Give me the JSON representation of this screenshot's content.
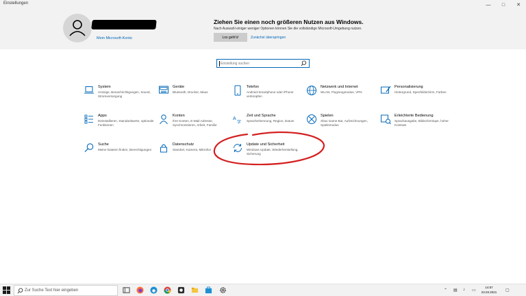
{
  "window": {
    "title": "Einstellungen"
  },
  "account": {
    "link": "Mein Microsoft-Konto"
  },
  "promo": {
    "title": "Ziehen Sie einen noch größeren Nutzen aus Windows.",
    "subtitle": "Nach Auswahl einiger weniger Optionen können Sie die vollständige Microsoft-Umgebung nutzen.",
    "primary_button": "Los geht's!",
    "secondary_link": "Zunächst überspringen"
  },
  "search": {
    "placeholder": "Einstellung suchen"
  },
  "tiles": [
    {
      "title": "System",
      "desc": "Anzeige, Benachrichtigungen, Sound, Stromversorgung",
      "icon": "laptop-icon"
    },
    {
      "title": "Geräte",
      "desc": "Bluetooth, Drucker, Maus",
      "icon": "keyboard-icon"
    },
    {
      "title": "Telefon",
      "desc": "Android-Smartphone oder iPhone verknüpfen",
      "icon": "phone-icon"
    },
    {
      "title": "Netzwerk und Internet",
      "desc": "WLAN, Flugzeugmodus, VPN",
      "icon": "globe-icon"
    },
    {
      "title": "Personalisierung",
      "desc": "Hintergrund, Sperrbildschirm, Farben",
      "icon": "brush-icon"
    },
    {
      "title": "Apps",
      "desc": "Deinstallieren, Standardwerte, optionale Funktionen",
      "icon": "apps-icon"
    },
    {
      "title": "Konten",
      "desc": "Ihre Konten, E-Mail-Adresse, Synchronisieren, Arbeit, Familie",
      "icon": "person-icon"
    },
    {
      "title": "Zeit und Sprache",
      "desc": "Spracherkennung, Region, Datum",
      "icon": "time-language-icon"
    },
    {
      "title": "Spielen",
      "desc": "Xbox Game Bar, Aufzeichnungen, Spielemodus",
      "icon": "xbox-icon"
    },
    {
      "title": "Erleichterte Bedienung",
      "desc": "Sprachausgabe, Bildschirmlupe, hoher Kontrast",
      "icon": "accessibility-icon"
    },
    {
      "title": "Suche",
      "desc": "Meine Dateien finden, Berechtigungen",
      "icon": "search-icon"
    },
    {
      "title": "Datenschutz",
      "desc": "Standort, Kamera, Mikrofon",
      "icon": "lock-icon"
    },
    {
      "title": "Update und Sicherheit",
      "desc": "Windows Update, Wiederherstellung, Sicherung",
      "icon": "sync-icon"
    }
  ],
  "taskbar": {
    "search_text": "Zur Suche Text hier eingeben",
    "time": "14:57",
    "date": "23.03.2021"
  },
  "colors": {
    "accent": "#0067b8",
    "annotation": "#d42020"
  }
}
